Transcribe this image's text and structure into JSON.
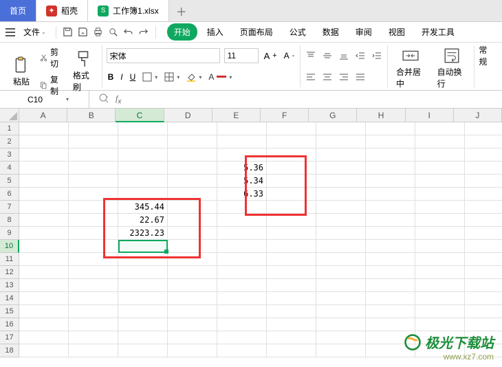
{
  "tabs": {
    "home": "首页",
    "dao": "稻壳",
    "file": "工作簿1.xlsx"
  },
  "menu": {
    "file": "文件",
    "ribbon_tabs": [
      "开始",
      "插入",
      "页面布局",
      "公式",
      "数据",
      "审阅",
      "视图",
      "开发工具"
    ]
  },
  "ribbon": {
    "cut": "剪切",
    "copy": "复制",
    "paste": "粘贴",
    "format_painter": "格式刷",
    "font_name": "宋体",
    "font_size": "11",
    "merge": "合并居中",
    "wrap": "自动换行",
    "general": "常规"
  },
  "formula": {
    "cell_ref": "C10"
  },
  "grid": {
    "columns": [
      "A",
      "B",
      "C",
      "D",
      "E",
      "F",
      "G",
      "H",
      "I",
      "J"
    ],
    "active_col": "C",
    "active_row": 10,
    "cells": {
      "E4": "5.36",
      "E5": "5.34",
      "E6": "6.33",
      "C7": "345.44",
      "C8": "22.67",
      "C9": "2323.23"
    }
  },
  "watermark": {
    "title": "极光下载站",
    "url": "www.xz7.com"
  }
}
